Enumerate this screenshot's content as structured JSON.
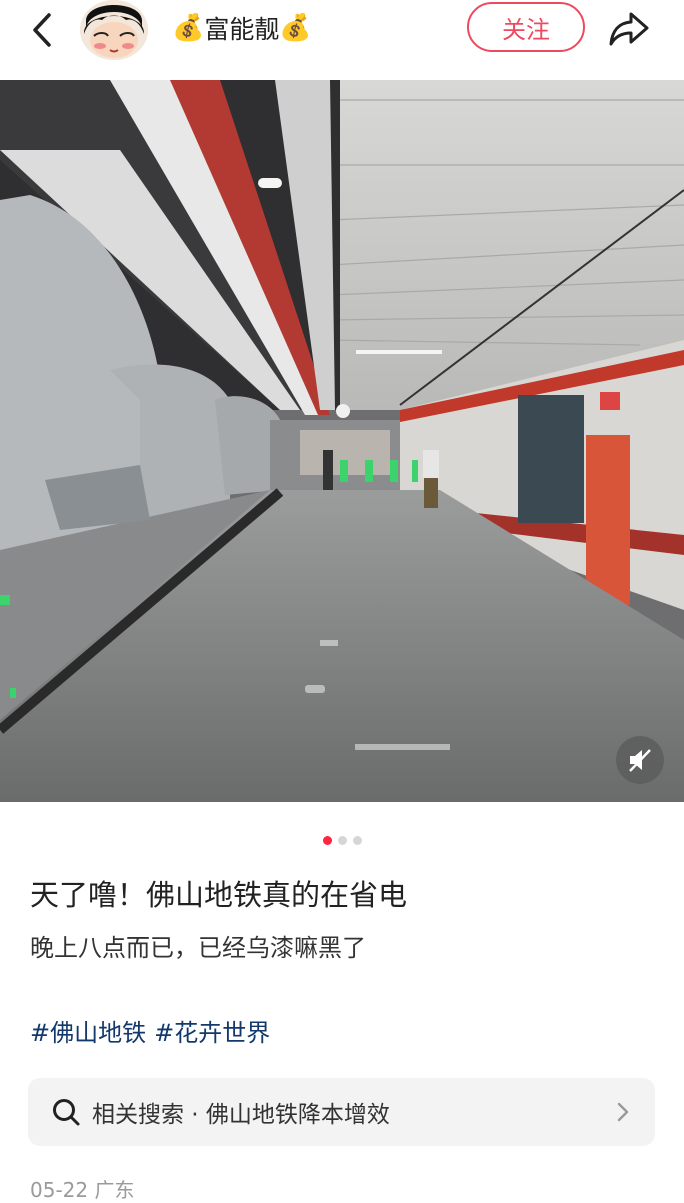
{
  "header": {
    "back_icon": "chevron-left-icon",
    "author_name": "富能靓",
    "author_decor": "💰",
    "follow_label": "关注",
    "share_icon": "share-arrow-icon",
    "accent_color": "#ee4a5f"
  },
  "media": {
    "image_alt": "佛山地铁站台",
    "mute_icon": "speaker-mute-icon",
    "carousel": {
      "count": 3,
      "active": 1
    }
  },
  "post": {
    "title": "天了噜！佛山地铁真的在省电",
    "body": "晚上八点而已，已经乌漆嘛黑了",
    "tags": [
      "#佛山地铁",
      "#花卉世界"
    ]
  },
  "related_search": {
    "icon": "search-icon",
    "text": "相关搜索 · 佛山地铁降本增效",
    "chevron_icon": "chevron-right-icon"
  },
  "meta": {
    "date_location": "05-22 广东"
  }
}
